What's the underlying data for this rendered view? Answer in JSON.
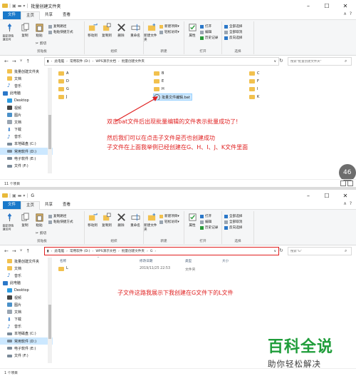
{
  "window1": {
    "title": "批量创建文件夹",
    "tabs": [
      "文件",
      "主页",
      "共享",
      "查看"
    ],
    "active_tab": "主页",
    "ribbon": {
      "clipboard": {
        "label": "剪贴板",
        "pin": "固定到快速访问",
        "copy": "复制",
        "paste": "粘贴",
        "copy_path": "复制路径",
        "paste_shortcut": "粘贴快捷方式",
        "cut": "剪切"
      },
      "organize": {
        "label": "组织",
        "move_to": "移动到",
        "copy_to": "复制到",
        "delete": "删除",
        "rename": "重命名"
      },
      "new": {
        "label": "新建",
        "new_folder": "新建文件夹",
        "new_item": "新建项目",
        "easy_access": "轻松访问"
      },
      "open": {
        "label": "打开",
        "properties": "属性",
        "open": "打开",
        "edit": "编辑",
        "history": "历史记录"
      },
      "select": {
        "label": "选择",
        "select_all": "全部选择",
        "select_none": "全部取消",
        "invert": "反向选择"
      }
    },
    "breadcrumbs": [
      "此电脑",
      "常用软件 (D:)",
      "WPS演示文档",
      "批量创建文件夹"
    ],
    "search_placeholder": "搜索\"批量创建文件夹\"",
    "sidebar": [
      "批量创建文件夹",
      "文档",
      "音乐",
      "此电脑",
      "Desktop",
      "视频",
      "图片",
      "文档",
      "下载",
      "音乐",
      "本地磁盘 (C:)",
      "常用软件 (D:)",
      "电子软件 (E:)",
      "文件 (F:)"
    ],
    "files": [
      "A",
      "B",
      "C",
      "D",
      "E",
      "F",
      "G",
      "H",
      "I",
      "J",
      "K"
    ],
    "bat_file": "批量文件编辑.bat",
    "status": "11 个项目",
    "annotations": [
      "双击bat文件后出现批量编辑的文件表示批量成功了!",
      "然后我们可以在点击子文件是否也创建成功",
      "子文件在上面我举例已经创建在G、H、I、J、K文件里面"
    ],
    "badge": "46"
  },
  "window2": {
    "title": "G",
    "tabs": [
      "文件",
      "主页",
      "共享",
      "查看"
    ],
    "active_tab": "主页",
    "breadcrumbs": [
      "此电脑",
      "常用软件 (D:)",
      "WPS演示文档",
      "批量创建文件夹",
      "G"
    ],
    "search_placeholder": "搜索\"G\"",
    "sidebar": [
      "批量创建文件夹",
      "文档",
      "音乐",
      "此电脑",
      "Desktop",
      "视频",
      "图片",
      "文档",
      "下载",
      "音乐",
      "本地磁盘 (C:)",
      "常用软件 (D:)",
      "电子软件 (E:)",
      "文件 (F:)"
    ],
    "columns": [
      "名称",
      "修改日期",
      "类型",
      "大小"
    ],
    "rows": [
      {
        "name": "L",
        "date": "2019/11/25 22:53",
        "type": "文件夹",
        "size": ""
      }
    ],
    "status": "1 个项目",
    "annotation": "子文件这路我展示下我创建在G文件下的L文件"
  },
  "watermark": {
    "brand": "百科全说",
    "slogan": "助你轻松解决"
  },
  "colors": {
    "file_tab": "#1979ca",
    "folder": "#f2c14e",
    "selection": "#cce8ff",
    "annotation": "#e02020",
    "brand": "#1f9d3a",
    "address_highlight": "#e02020"
  }
}
